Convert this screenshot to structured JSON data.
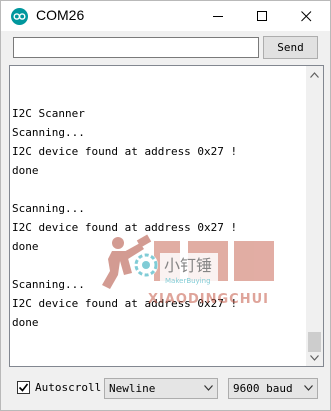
{
  "window": {
    "title": "COM26"
  },
  "send": {
    "input_value": "",
    "button_label": "Send"
  },
  "output": {
    "lines": [
      "",
      "",
      "I2C Scanner",
      "Scanning...",
      "I2C device found at address 0x27 !",
      "done",
      "",
      "Scanning...",
      "I2C device found at address 0x27 !",
      "done",
      "",
      "Scanning...",
      "I2C device found at address 0x27 !",
      "done"
    ]
  },
  "footer": {
    "autoscroll_label": "Autoscroll",
    "autoscroll_checked": true,
    "line_ending": "Newline",
    "baud": "9600 baud"
  },
  "watermark": {
    "brand_cn": "小钉锤",
    "brand_en": "MakerBuying",
    "brand_pinyin": "XIAODINGCHUI"
  },
  "colors": {
    "arduino_teal": "#00979d",
    "watermark_red": "#b04a3a"
  }
}
